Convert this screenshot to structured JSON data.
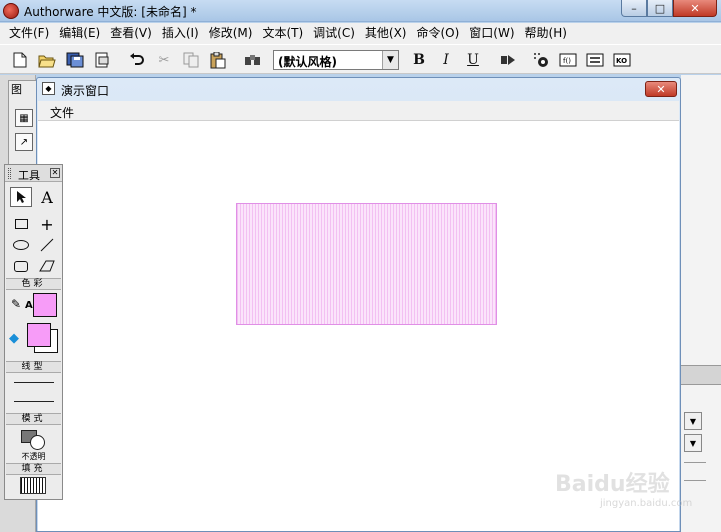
{
  "app": {
    "title": "Authorware 中文版: [未命名] *",
    "window_buttons": {
      "minimize": "–",
      "maximize": "□",
      "close": "✕"
    }
  },
  "menubar": {
    "items": [
      {
        "label": "文件(F)"
      },
      {
        "label": "编辑(E)"
      },
      {
        "label": "查看(V)"
      },
      {
        "label": "插入(I)"
      },
      {
        "label": "修改(M)"
      },
      {
        "label": "文本(T)"
      },
      {
        "label": "调试(C)"
      },
      {
        "label": "其他(X)"
      },
      {
        "label": "命令(O)"
      },
      {
        "label": "窗口(W)"
      },
      {
        "label": "帮助(H)"
      }
    ]
  },
  "toolbar": {
    "style_combo_value": "(默认风格)",
    "bold_label": "B",
    "italic_label": "I",
    "underline_label": "U"
  },
  "icon_panel": {
    "title": "图"
  },
  "presentation_window": {
    "title": "演示窗口",
    "menu_file": "文件",
    "close_label": "✕",
    "rect_color": "#f79cf8"
  },
  "tools": {
    "title": "工具",
    "close_label": "✕",
    "text_tool_label": "A",
    "sections": {
      "color": "色彩",
      "line": "线型",
      "mode": "模式",
      "fill": "填充"
    },
    "text_color_label": "A",
    "mode_value": "不透明",
    "line_color": "#f79cf8",
    "fill_color": "#f79cf8"
  },
  "watermark": {
    "main": "Baidu经验",
    "sub": "jingyan.baidu.com"
  }
}
